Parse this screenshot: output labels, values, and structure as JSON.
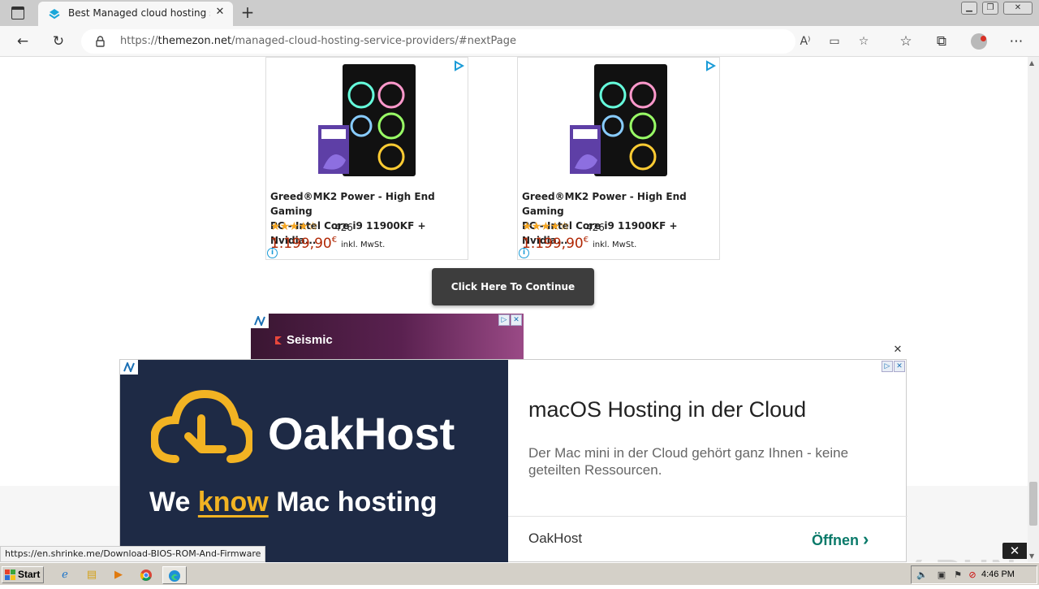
{
  "browser": {
    "tab_title": "Best Managed cloud hosting ser",
    "new_tab_symbol": "+",
    "tab_close_symbol": "✕",
    "url_prefix": "https://",
    "url_host": "themezon.net",
    "url_path": "/managed-cloud-hosting-service-providers/#nextPage",
    "status_url": "https://en.shrinke.me/Download-BIOS-ROM-And-Firmware"
  },
  "products": [
    {
      "name_line1": "Greed®MK2 Power - High End Gaming",
      "name_line2": "PC - Intel Core i9 11900KF + Nvidia...",
      "stars": "★★★★☆",
      "rating_fraction": 0.8,
      "reviews": "426",
      "price": "1.199,90",
      "currency": "€",
      "vat": "inkl. MwSt."
    },
    {
      "name_line1": "Greed®MK2 Power - High End Gaming",
      "name_line2": "PC - Intel Core i9 11900KF + Nvidia...",
      "stars": "★★★★☆",
      "rating_fraction": 0.8,
      "reviews": "426",
      "price": "1.199,90",
      "currency": "€",
      "vat": "inkl. MwSt."
    }
  ],
  "continue_button": "Click Here To Continue",
  "seismic_ad": {
    "brand": "Seismic"
  },
  "oak_ad": {
    "wordmark": "OakHost",
    "tagline_pre": "We ",
    "tagline_highlight": "know",
    "tagline_post": " Mac hosting",
    "headline": "macOS Hosting in der Cloud",
    "description": "Der Mac mini in der Cloud gehört ganz Ihnen - keine geteilten Ressourcen.",
    "brand": "OakHost",
    "cta": "Öffnen",
    "cta_arrow": "›",
    "close_symbol": "✕"
  },
  "overlay_close_symbol": "✕",
  "watermark": "ANY RUN",
  "taskbar": {
    "start_label": "Start",
    "clock": "4:46 PM"
  },
  "colors": {
    "price_red": "#b12704",
    "star_gold": "#f5a623",
    "oak_navy": "#1e2a45",
    "oak_yellow": "#f2b323",
    "oak_cta_green": "#0a7a6a"
  }
}
